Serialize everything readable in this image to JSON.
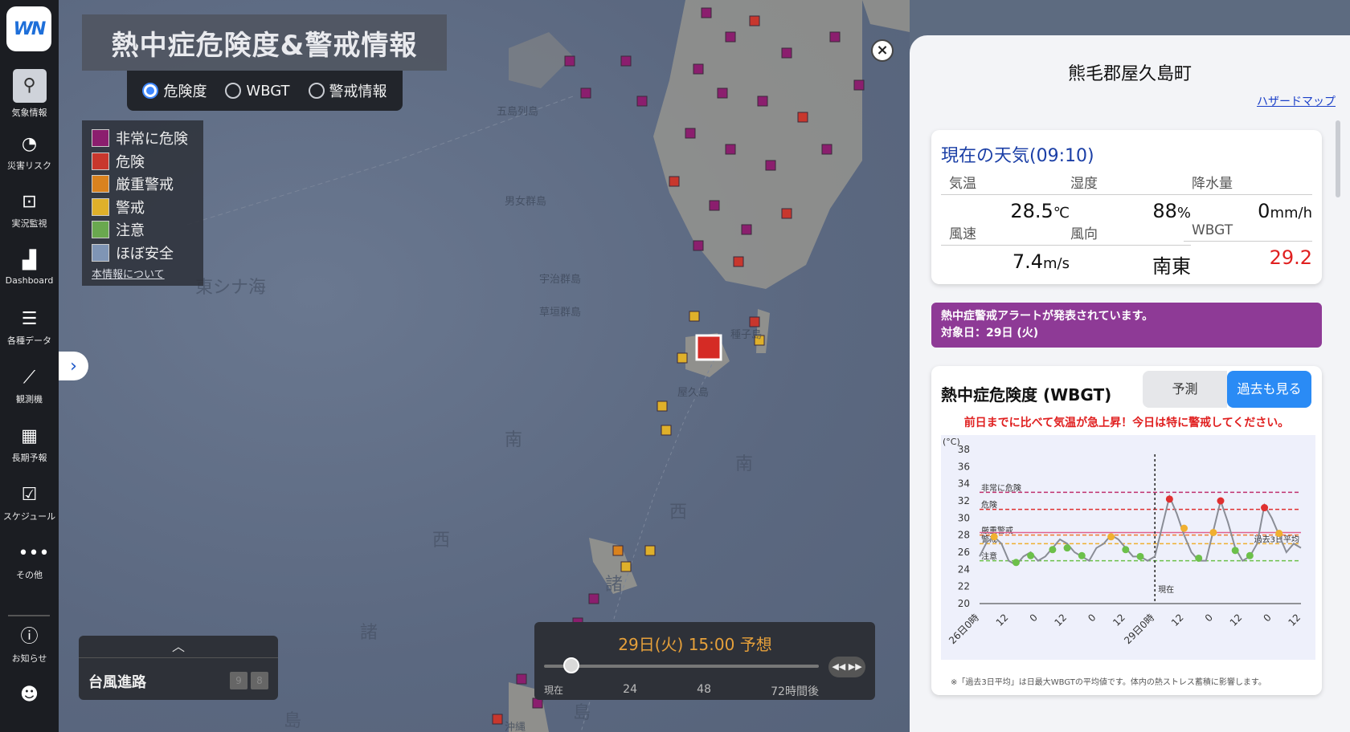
{
  "nav": {
    "logo": "WN",
    "items": [
      {
        "label": "気象情報",
        "icon": "map-pin-icon"
      },
      {
        "label": "災害リスク",
        "icon": "gauge-icon"
      },
      {
        "label": "実況監視",
        "icon": "camera-focus-icon"
      },
      {
        "label": "Dashboard",
        "icon": "bar-chart-icon"
      },
      {
        "label": "各種データ",
        "icon": "database-icon"
      },
      {
        "label": "観測機",
        "icon": "line-chart-icon"
      },
      {
        "label": "長期予報",
        "icon": "calendar-icon"
      },
      {
        "label": "スケジュール",
        "icon": "calendar-check-icon"
      },
      {
        "label": "その他",
        "icon": "more-icon"
      },
      {
        "label": "お知らせ",
        "icon": "info-icon"
      }
    ]
  },
  "map": {
    "title": "熱中症危険度&警戒情報",
    "modes": [
      "危険度",
      "WBGT",
      "警戒情報"
    ],
    "selected_mode": "危険度",
    "legend": [
      {
        "label": "非常に危険",
        "color": "#8b1e6e"
      },
      {
        "label": "危険",
        "color": "#c8372d"
      },
      {
        "label": "厳重警戒",
        "color": "#d9821e"
      },
      {
        "label": "警戒",
        "color": "#dfb02a"
      },
      {
        "label": "注意",
        "color": "#6aa84f"
      },
      {
        "label": "ほぼ安全",
        "color": "#7f95b5"
      }
    ],
    "legend_link": "本情報について",
    "place_labels": [
      "男女群島",
      "宇治群島",
      "草垣群島",
      "東シナ海",
      "南",
      "西",
      "諸",
      "島",
      "南",
      "西",
      "諸",
      "島",
      "種子島",
      "屋久島",
      "五島列島",
      "沖縄"
    ],
    "typhoon": {
      "label": "台風進路",
      "nums": [
        "9",
        "8"
      ]
    },
    "time": {
      "label": "29日(火) 15:00 予想",
      "ticks": [
        "現在",
        "24",
        "48",
        "72時間後"
      ],
      "controls": "◀◀ ▶▶"
    }
  },
  "panel": {
    "location": "熊毛郡屋久島町",
    "hazard_link": "ハザードマップ",
    "weather": {
      "title": "現在の天気(09:10)",
      "cells": [
        {
          "k": "気温",
          "v": "28.5",
          "u": "℃"
        },
        {
          "k": "湿度",
          "v": "88",
          "u": "%"
        },
        {
          "k": "降水量",
          "v": "0",
          "u": "mm/h"
        },
        {
          "k": "風速",
          "v": "7.4",
          "u": "m/s"
        },
        {
          "k": "風向",
          "v": "南東",
          "u": ""
        },
        {
          "k": "WBGT",
          "v": "29.2",
          "u": ""
        }
      ]
    },
    "alert": {
      "line1": "熱中症警戒アラートが発表されています。",
      "line2": "対象日：29日 (火)"
    },
    "wbgt": {
      "title": "熱中症危険度 (WBGT)",
      "btn_forecast": "予測",
      "btn_past": "過去も見る",
      "warning": "前日までに比べて気温が急上昇！今日は特に警戒してください。",
      "note": "※「過去3日平均」は日最大WBGTの平均値です。体内の熱ストレス蓄積に影響します。"
    }
  },
  "chart_data": {
    "type": "line",
    "ylabel": "(°C)",
    "ylim": [
      20,
      38
    ],
    "yticks": [
      38,
      36,
      34,
      32,
      30,
      28,
      26,
      24,
      22,
      20
    ],
    "xticks": [
      "26日0時",
      "12",
      "0",
      "12",
      "0",
      "12",
      "29日0時",
      "12",
      "0",
      "12",
      "0",
      "12"
    ],
    "xlim": [
      0,
      132
    ],
    "now_x": 72,
    "now_label": "現在",
    "thresholds": [
      {
        "name": "非常に危険",
        "value": 33,
        "color": "#c0306e"
      },
      {
        "name": "危険",
        "value": 31,
        "color": "#e03030"
      },
      {
        "name": "厳重警戒",
        "value": 28,
        "color": "#f07a30"
      },
      {
        "name": "警戒",
        "value": 27,
        "color": "#f0b030"
      },
      {
        "name": "注意",
        "value": 25,
        "color": "#6cc04a"
      }
    ],
    "avg3": {
      "label": "過去3日平均",
      "value": 28.3,
      "color": "#e06090"
    },
    "series": [
      {
        "name": "WBGT",
        "x": [
          0,
          3,
          6,
          9,
          12,
          15,
          18,
          21,
          24,
          27,
          30,
          33,
          36,
          39,
          42,
          45,
          48,
          51,
          54,
          57,
          60,
          63,
          66,
          69,
          72,
          75,
          78,
          81,
          84,
          87,
          90,
          93,
          96,
          99,
          102,
          105,
          108,
          111,
          114,
          117,
          120,
          123,
          126,
          129,
          132
        ],
        "values": [
          25.5,
          27.2,
          27.8,
          27,
          25,
          24.5,
          25.5,
          26,
          25,
          25.5,
          26.5,
          27.5,
          27,
          26,
          25.5,
          25,
          26.5,
          27,
          28,
          27.5,
          26.5,
          25.5,
          25.5,
          25,
          25.5,
          29,
          32.5,
          30.5,
          28,
          26,
          25,
          25,
          28.5,
          32,
          29.5,
          26.5,
          25,
          25.5,
          27,
          31.5,
          30,
          28,
          26,
          27,
          26.5
        ]
      }
    ],
    "markers": [
      {
        "x": 6,
        "y": 27.8,
        "level": "警戒"
      },
      {
        "x": 15,
        "y": 24.8,
        "level": "注意"
      },
      {
        "x": 21,
        "y": 25.6,
        "level": "注意"
      },
      {
        "x": 30,
        "y": 26.3,
        "level": "注意"
      },
      {
        "x": 36,
        "y": 26.5,
        "level": "注意"
      },
      {
        "x": 42,
        "y": 25.6,
        "level": "注意"
      },
      {
        "x": 54,
        "y": 27.8,
        "level": "警戒"
      },
      {
        "x": 60,
        "y": 26.3,
        "level": "注意"
      },
      {
        "x": 66,
        "y": 25.5,
        "level": "注意"
      },
      {
        "x": 78,
        "y": 32.2,
        "level": "危険"
      },
      {
        "x": 84,
        "y": 28.8,
        "level": "警戒"
      },
      {
        "x": 90,
        "y": 25.3,
        "level": "注意"
      },
      {
        "x": 96,
        "y": 28.3,
        "level": "警戒"
      },
      {
        "x": 99,
        "y": 32.0,
        "level": "危険"
      },
      {
        "x": 105,
        "y": 26.2,
        "level": "注意"
      },
      {
        "x": 111,
        "y": 25.6,
        "level": "注意"
      },
      {
        "x": 117,
        "y": 31.2,
        "level": "危険"
      },
      {
        "x": 123,
        "y": 28.2,
        "level": "警戒"
      }
    ]
  }
}
